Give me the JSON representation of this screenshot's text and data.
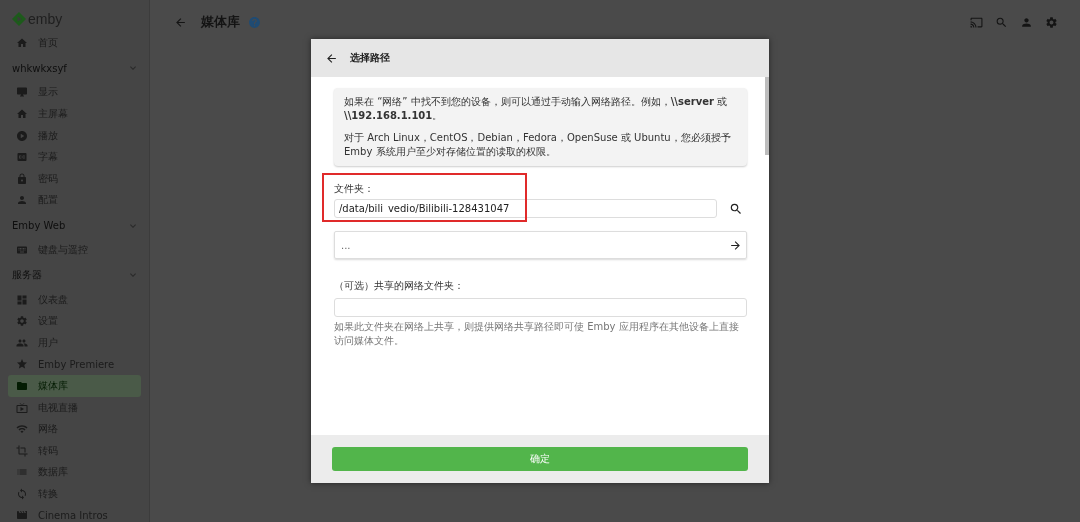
{
  "sidebar": {
    "logo": "emby",
    "home": {
      "label": "首页",
      "selected": false
    },
    "sections": [
      {
        "title": "whkwkxsyf",
        "items": [
          {
            "label": "显示",
            "selected": false
          },
          {
            "label": "主屏幕",
            "selected": false
          },
          {
            "label": "播放",
            "selected": false
          },
          {
            "label": "字幕",
            "selected": false
          },
          {
            "label": "密码",
            "selected": false
          },
          {
            "label": "配置",
            "selected": false
          }
        ]
      },
      {
        "title": "Emby Web",
        "items": [
          {
            "label": "键盘与遥控",
            "selected": false
          }
        ]
      },
      {
        "title": "服务器",
        "items": [
          {
            "label": "仪表盘",
            "selected": false
          },
          {
            "label": "设置",
            "selected": false
          },
          {
            "label": "用户",
            "selected": false
          },
          {
            "label": "Emby Premiere",
            "selected": false
          },
          {
            "label": "媒体库",
            "selected": true
          },
          {
            "label": "电视直播",
            "selected": false
          },
          {
            "label": "网络",
            "selected": false
          },
          {
            "label": "转码",
            "selected": false
          },
          {
            "label": "数据库",
            "selected": false
          },
          {
            "label": "转换",
            "selected": false
          },
          {
            "label": "Cinema Intros",
            "selected": false
          }
        ]
      }
    ]
  },
  "header": {
    "title": "媒体库"
  },
  "dialog": {
    "title": "选择路径",
    "info": [
      "如果在 “网络” 中找不到您的设备，则可以通过手动输入网络路径。例如，**\\\\server** 或 **\\\\192.168.1.101**。",
      "对于 Arch Linux，CentOS，Debian，Fedora，OpenSuse 或 Ubuntu，您必须授予 Emby 系统用户至少对存储位置的读取的权限。"
    ],
    "folder": {
      "label": "文件夹：",
      "value": "/data/bili_vedio/Bilibili-128431047",
      "highlighted": true
    },
    "picker": {
      "value": "..."
    },
    "network_share": {
      "label": "（可选）共享的网络文件夹：",
      "help": "如果此文件夹在网络上共享，则提供网络共享路径即可使 Emby 应用程序在其他设备上直接访问媒体文件。"
    },
    "confirm_button": "确定"
  }
}
